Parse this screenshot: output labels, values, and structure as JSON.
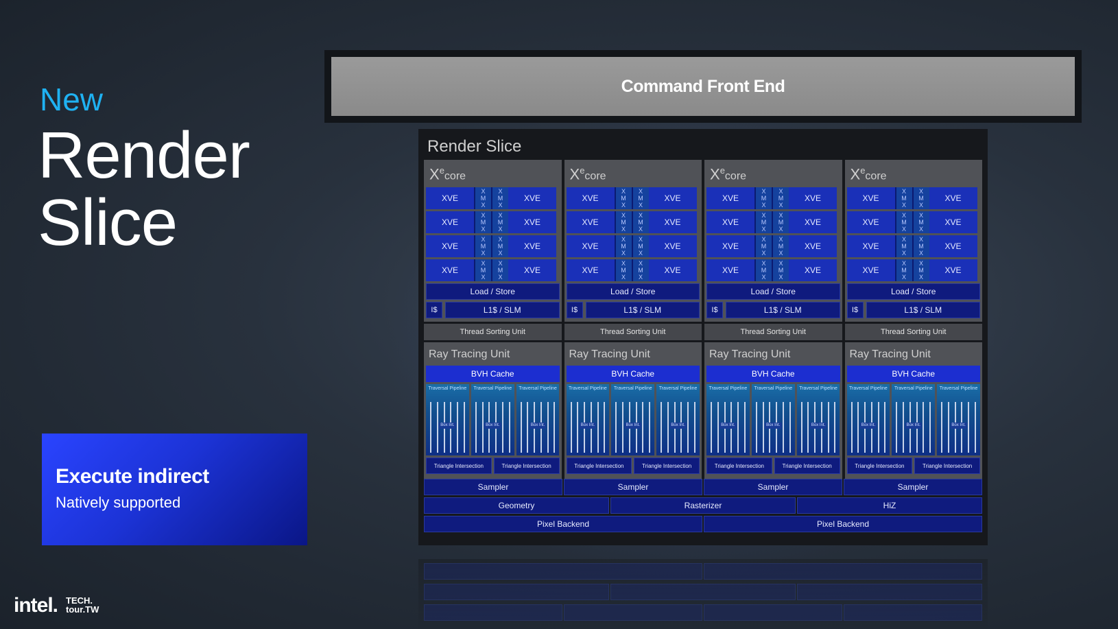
{
  "left": {
    "eyebrow": "New",
    "title_line1": "Render",
    "title_line2": "Slice",
    "callout": {
      "title": "Execute indirect",
      "subtitle": "Natively supported"
    }
  },
  "branding": {
    "logo_text": "intel.",
    "event_line1": "TECH.",
    "event_line2": "tour.TW"
  },
  "diagram": {
    "command_front_end": "Command Front End",
    "render_slice_title": "Render Slice",
    "xe_core": {
      "xe": "X",
      "e": "e",
      "core": "core"
    },
    "xve_label": "XVE",
    "xmx_letters": [
      "X",
      "M",
      "X"
    ],
    "load_store": "Load / Store",
    "is_label": "I$",
    "l1_label": "L1$ / SLM",
    "thread_sorting_unit": "Thread Sorting Unit",
    "ray_tracing_unit": "Ray Tracing Unit",
    "bvh_cache": "BVH Cache",
    "traversal_pipeline": "Traversal Pipeline",
    "box_int": "Box Int.",
    "triangle_intersection": "Triangle Intersection",
    "samplers": [
      "Sampler",
      "Sampler",
      "Sampler",
      "Sampler"
    ],
    "geometry_row": [
      "Geometry",
      "Rasterizer",
      "HiZ"
    ],
    "pixel_backends": [
      "Pixel Backend",
      "Pixel Backend"
    ],
    "core_count": 4,
    "xve_rows_per_core": 4,
    "traversal_per_rtu": 3,
    "triangle_per_rtu": 2
  },
  "colors": {
    "accent_cyan": "#1fb2f2",
    "block_blue": "#1a30b8",
    "callout_blue": "#2a44ff",
    "core_gray": "#505257"
  }
}
